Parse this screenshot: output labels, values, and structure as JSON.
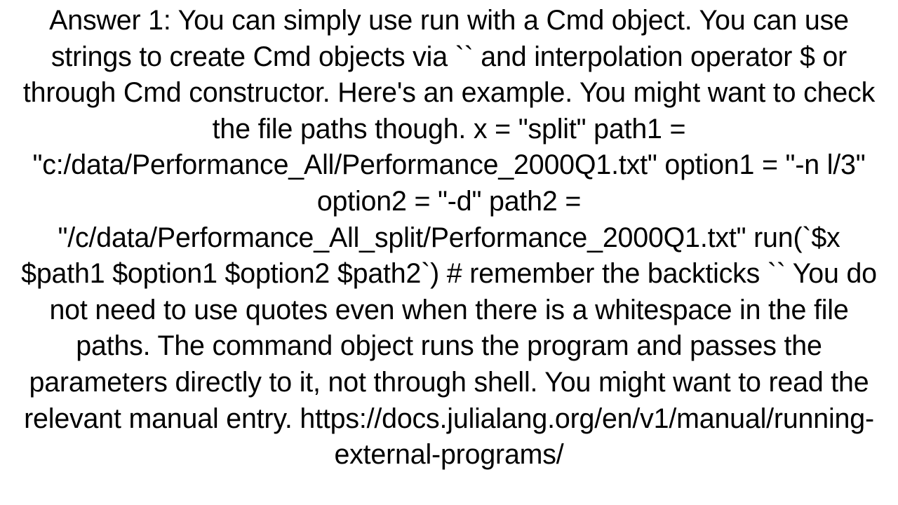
{
  "page": {
    "background_color": "#ffffff",
    "text_color": "#000000",
    "alignment": "center"
  },
  "answer": {
    "label": "Answer 1:",
    "full_text": "Answer 1: You can simply use run with a Cmd object. You can use strings to create Cmd objects via `` and interpolation operator $ or through Cmd constructor. Here's an example. You might want to check the file paths though. x = \"split\" path1 = \"c:/data/Performance_All/Performance_2000Q1.txt\" option1 = \"-n l/3\" option2 = \"-d\" path2 = \"/c/data/Performance_All_split/Performance_2000Q1.txt\" run(`$x $path1 $option1 $option2 $path2`) # remember the backticks ``  You do not need to use quotes even when there is a whitespace in the file paths. The command object runs the program and passes the parameters directly to it, not through shell. You might want to read the relevant manual entry. https://docs.julialang.org/en/v1/manual/running-external-programs/",
    "rendered_lines": [
      "Answer 1: You can simply use run with a Cmd object. You can",
      "use strings to create Cmd objects via `` and interpolation",
      "operator $ or through Cmd constructor. Here's an example.",
      "You might want to check the file paths though. x = \"split\"",
      "path1 = \"c:/data/Performance_All/Performance_2000Q1.txt\"",
      "option1 = \"-n l/3\" option2 = \"-d\" path2 =",
      "\"/c/data/Performance_All_split/Performance_2000Q1.txt\"",
      "run(`$x $path1 $option1 $option2 $path2`) # remember the",
      "backticks ``  You do not need to use quotes even when there",
      "is a whitespace in the file paths. The command object runs",
      "the program and passes the parameters directly to it, not",
      "through shell. You might want to read the relevant manual",
      "entry. https://docs.julialang.org/en/v1/manual/running-",
      "external-programs/"
    ],
    "code_snippet": {
      "x": "x = \"split\"",
      "path1": "path1 = \"c:/data/Performance_All/Performance_2000Q1.txt\"",
      "option1": "option1 = \"-n l/3\"",
      "option2": "option2 = \"-d\"",
      "path2": "path2 = \"/c/data/Performance_All_split/Performance_2000Q1.txt\"",
      "run_call": "run(`$x $path1 $option1 $option2 $path2`)",
      "comment": "# remember the backticks ``"
    },
    "link": "https://docs.julialang.org/en/v1/manual/running-external-programs/"
  }
}
